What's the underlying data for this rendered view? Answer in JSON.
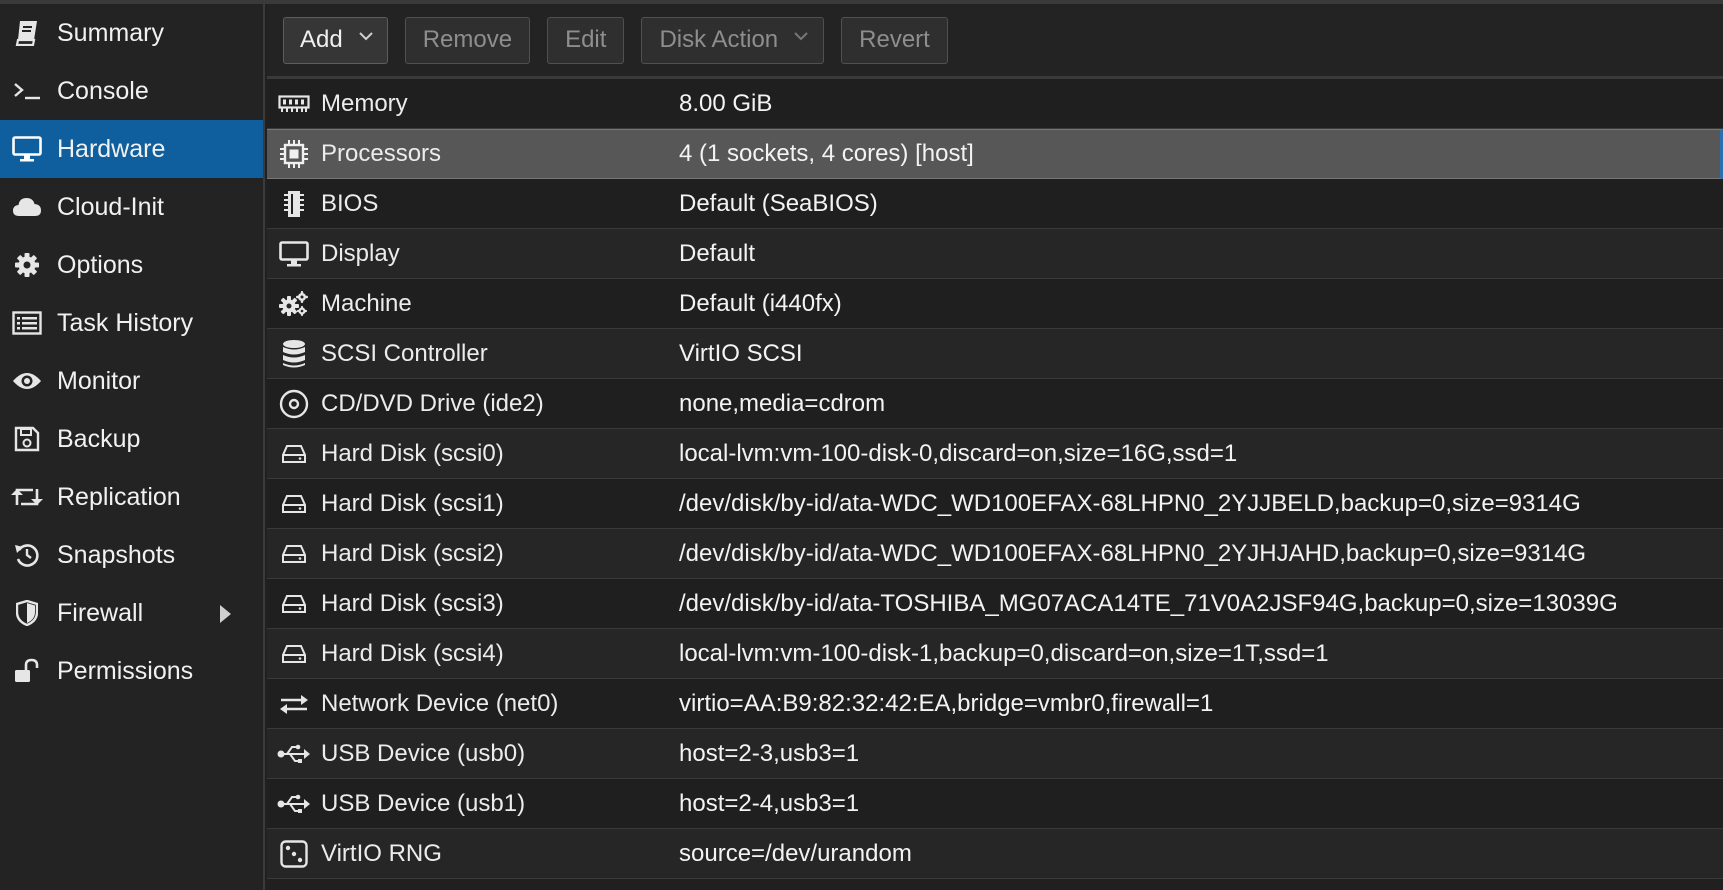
{
  "sidebar": {
    "items": [
      {
        "label": "Summary",
        "icon": "book-icon"
      },
      {
        "label": "Console",
        "icon": "terminal-icon"
      },
      {
        "label": "Hardware",
        "icon": "monitor-icon",
        "active": true
      },
      {
        "label": "Cloud-Init",
        "icon": "cloud-icon"
      },
      {
        "label": "Options",
        "icon": "gear-icon"
      },
      {
        "label": "Task History",
        "icon": "list-icon"
      },
      {
        "label": "Monitor",
        "icon": "eye-icon"
      },
      {
        "label": "Backup",
        "icon": "floppy-icon"
      },
      {
        "label": "Replication",
        "icon": "retweet-icon"
      },
      {
        "label": "Snapshots",
        "icon": "history-icon"
      },
      {
        "label": "Firewall",
        "icon": "shield-icon",
        "has_submenu": true
      },
      {
        "label": "Permissions",
        "icon": "unlock-icon"
      }
    ]
  },
  "toolbar": {
    "add_label": "Add",
    "remove_label": "Remove",
    "edit_label": "Edit",
    "disk_action_label": "Disk Action",
    "revert_label": "Revert"
  },
  "hardware": {
    "rows": [
      {
        "name": "Memory",
        "value": "8.00 GiB",
        "icon": "memory-icon"
      },
      {
        "name": "Processors",
        "value": "4 (1 sockets, 4 cores) [host]",
        "icon": "cpu-icon",
        "selected": true
      },
      {
        "name": "BIOS",
        "value": "Default (SeaBIOS)",
        "icon": "microchip-icon"
      },
      {
        "name": "Display",
        "value": "Default",
        "icon": "desktop-icon"
      },
      {
        "name": "Machine",
        "value": "Default (i440fx)",
        "icon": "cogs-icon"
      },
      {
        "name": "SCSI Controller",
        "value": "VirtIO SCSI",
        "icon": "database-icon"
      },
      {
        "name": "CD/DVD Drive (ide2)",
        "value": "none,media=cdrom",
        "icon": "cdrom-icon"
      },
      {
        "name": "Hard Disk (scsi0)",
        "value": "local-lvm:vm-100-disk-0,discard=on,size=16G,ssd=1",
        "icon": "hdd-icon"
      },
      {
        "name": "Hard Disk (scsi1)",
        "value": "/dev/disk/by-id/ata-WDC_WD100EFAX-68LHPN0_2YJJBELD,backup=0,size=9314G",
        "icon": "hdd-icon"
      },
      {
        "name": "Hard Disk (scsi2)",
        "value": "/dev/disk/by-id/ata-WDC_WD100EFAX-68LHPN0_2YJHJAHD,backup=0,size=9314G",
        "icon": "hdd-icon"
      },
      {
        "name": "Hard Disk (scsi3)",
        "value": "/dev/disk/by-id/ata-TOSHIBA_MG07ACA14TE_71V0A2JSF94G,backup=0,size=13039G",
        "icon": "hdd-icon"
      },
      {
        "name": "Hard Disk (scsi4)",
        "value": "local-lvm:vm-100-disk-1,backup=0,discard=on,size=1T,ssd=1",
        "icon": "hdd-icon"
      },
      {
        "name": "Network Device (net0)",
        "value": "virtio=AA:B9:82:32:42:EA,bridge=vmbr0,firewall=1",
        "icon": "exchange-icon"
      },
      {
        "name": "USB Device (usb0)",
        "value": "host=2-3,usb3=1",
        "icon": "usb-icon"
      },
      {
        "name": "USB Device (usb1)",
        "value": "host=2-4,usb3=1",
        "icon": "usb-icon"
      },
      {
        "name": "VirtIO RNG",
        "value": "source=/dev/urandom",
        "icon": "dice-icon"
      }
    ]
  },
  "colors": {
    "active_nav": "#0f5f9e",
    "selected_row": "#575757",
    "background": "#212121"
  }
}
